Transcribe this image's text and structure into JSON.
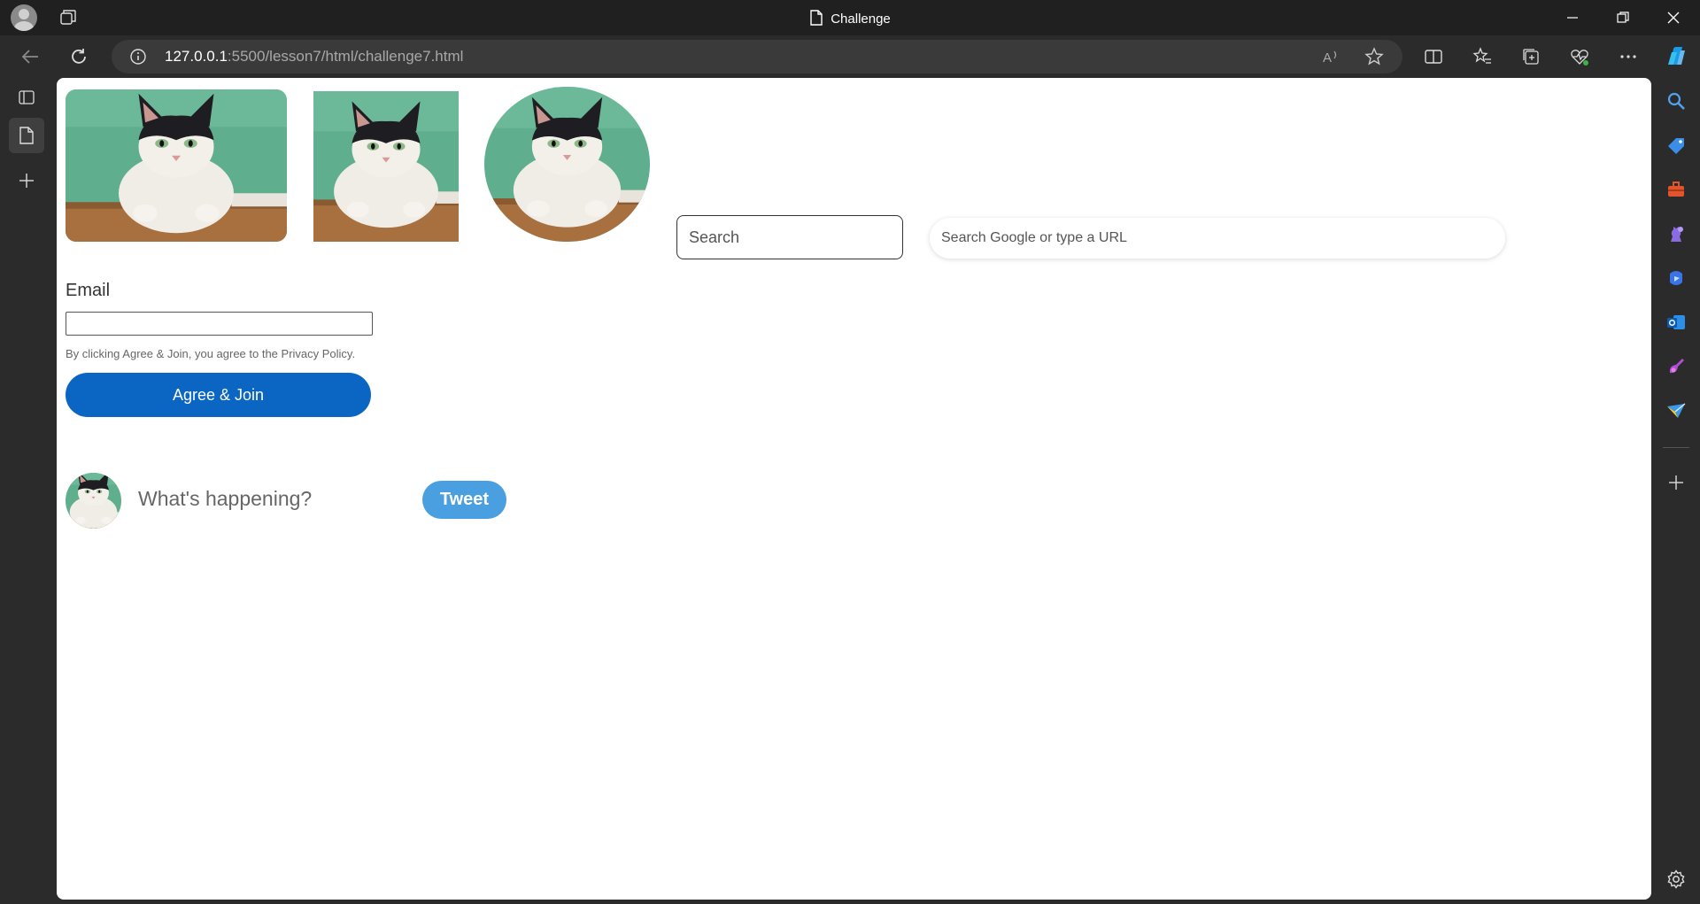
{
  "window": {
    "title": "Challenge"
  },
  "addressbar": {
    "url_host": "127.0.0.1",
    "url_rest": ":5500/lesson7/html/challenge7.html"
  },
  "page": {
    "search_placeholder": "Search",
    "google_search_placeholder": "Search Google or type a URL",
    "email_label": "Email",
    "email_value": "",
    "privacy_text": "By clicking Agree & Join, you agree to the Privacy Policy.",
    "join_button": "Agree & Join",
    "compose_placeholder": "What's happening?",
    "tweet_button": "Tweet"
  },
  "icons": {
    "titlebar": [
      "profile-icon",
      "workspaces-icon",
      "document-icon",
      "minimize-icon",
      "restore-icon",
      "close-icon"
    ],
    "toolbar": [
      "back-icon",
      "refresh-icon",
      "info-icon",
      "read-aloud-icon",
      "favorite-star-icon",
      "split-screen-icon",
      "favorites-icon",
      "collections-icon",
      "browser-essentials-icon",
      "more-icon",
      "copilot-icon"
    ],
    "leftbar": [
      "tab-actions-icon",
      "page-tab-icon",
      "new-tab-icon"
    ],
    "rightbar": [
      "search-icon",
      "shopping-icon",
      "tools-icon",
      "games-icon",
      "m365-icon",
      "outlook-icon",
      "designer-icon",
      "drop-icon",
      "add-icon",
      "settings-icon"
    ]
  },
  "colors": {
    "join_button": "#0a66c2",
    "tweet_button": "#4a9fe0",
    "cat_background": "#5fae8e"
  }
}
